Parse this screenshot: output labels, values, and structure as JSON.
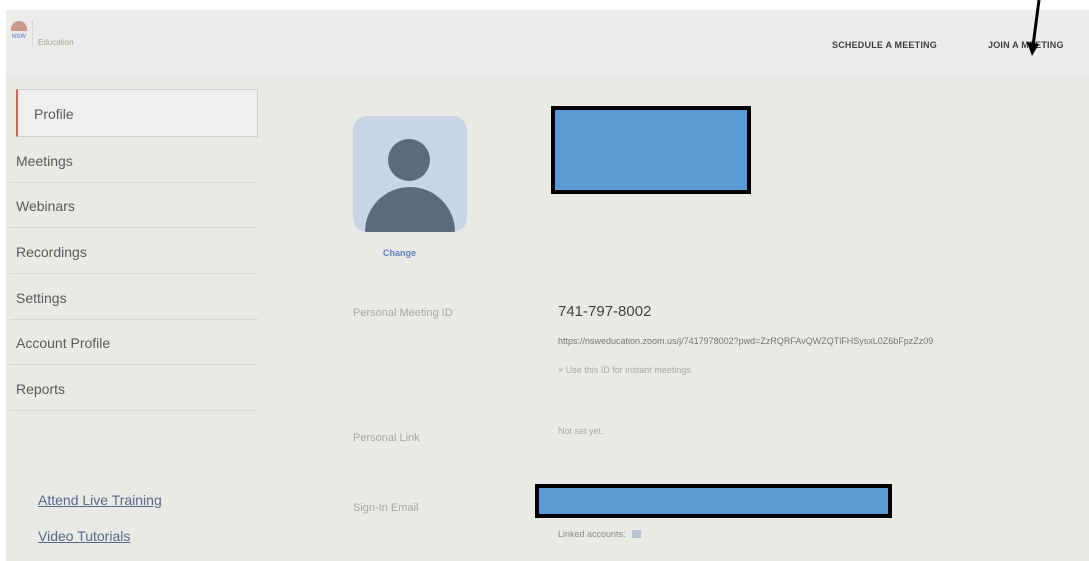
{
  "header": {
    "logo_text": "NSW",
    "brand": "Education",
    "schedule_label": "SCHEDULE A MEETING",
    "join_label": "JOIN A MEETING"
  },
  "sidebar": {
    "items": [
      {
        "label": "Profile",
        "active": true
      },
      {
        "label": "Meetings"
      },
      {
        "label": "Webinars"
      },
      {
        "label": "Recordings"
      },
      {
        "label": "Settings"
      },
      {
        "label": "Account Profile"
      },
      {
        "label": "Reports"
      }
    ],
    "links": [
      {
        "label": "Attend Live Training"
      },
      {
        "label": "Video Tutorials"
      }
    ]
  },
  "profile": {
    "change_label": "Change",
    "personal_meeting_id_label": "Personal Meeting ID",
    "personal_meeting_id": "741-797-8002",
    "meeting_url": "https://nsweducation.zoom.us/j/7417978002?pwd=ZzRQRFAvQWZQTlFHSysxL0Z6bFpzZz09",
    "instant_note": "× Use this ID for instant meetings",
    "personal_link_label": "Personal Link",
    "personal_link_value": "Not set yet.",
    "sign_in_email_label": "Sign-In Email",
    "linked_accounts_label": "Linked accounts:"
  },
  "colors": {
    "redaction_fill": "#5b9bd5",
    "active_accent": "#c46a5a",
    "link_blue": "#5d84b8"
  },
  "icons": [
    "logo-icon",
    "user-avatar-icon",
    "linked-account-icon",
    "annotation-arrow-icon"
  ]
}
